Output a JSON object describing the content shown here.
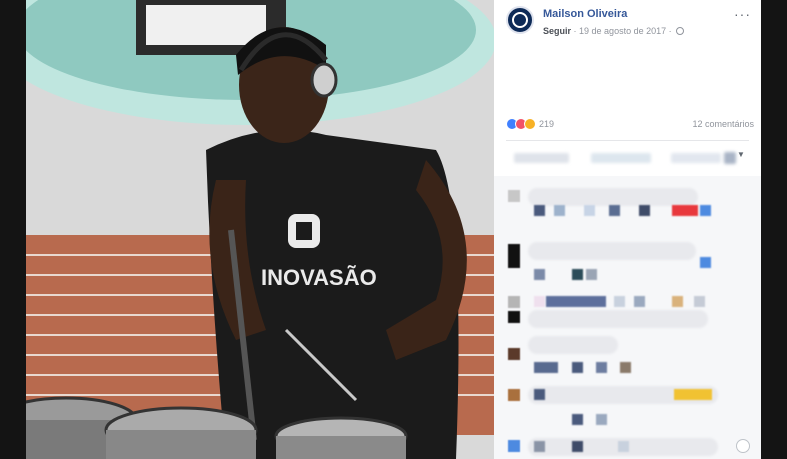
{
  "post": {
    "author": "Mailson Oliveira",
    "follow": "Seguir",
    "date": "19 de agosto de 2017",
    "more": "···"
  },
  "reactions": {
    "count": "219",
    "comments": "12 comentários"
  },
  "photo": {
    "shirt_text": "INOVASÃO"
  },
  "colors": {
    "link_blue": "#365899",
    "meta_gray": "#90949c",
    "like_blue": "#4080ff",
    "love_red": "#f25268",
    "wow_yellow": "#f7b125"
  },
  "icons": {
    "privacy": "globe-icon",
    "options": "more-options-icon",
    "emoji": "emoji-icon"
  }
}
